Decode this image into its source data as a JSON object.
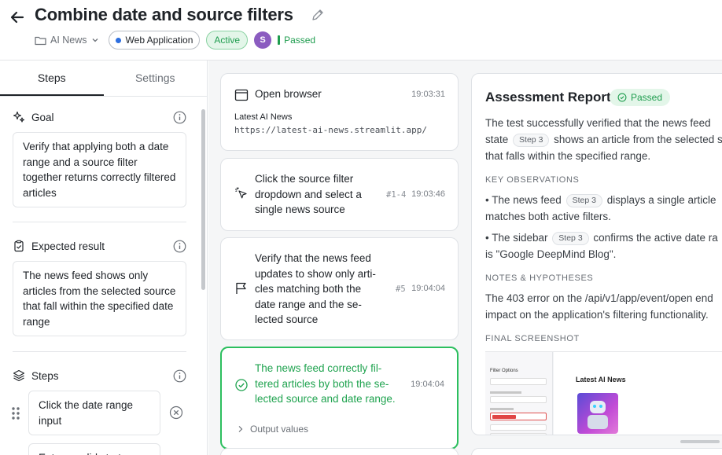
{
  "header": {
    "title": "Combine date and source filters",
    "folder": "AI News",
    "environment": "Web Application",
    "status": "Active",
    "avatar_initial": "S",
    "result": "Passed"
  },
  "left_panel": {
    "tabs": [
      "Steps",
      "Settings"
    ],
    "goal": {
      "label": "Goal",
      "text": "Verify that applying both a date range and a source filter together returns correctly filtered articles"
    },
    "expected": {
      "label": "Expected result",
      "text": "The news feed shows only articles from the selected source that fall within the specified date range"
    },
    "steps": {
      "label": "Steps",
      "items": [
        "Click the date range input",
        "Enter a valid start..."
      ]
    }
  },
  "timeline": [
    {
      "title": "Open browser",
      "time": "19:03:31",
      "subtitle": "Latest AI News",
      "url": "https://latest-ai-news.streamlit.app/"
    },
    {
      "text": "Click the source filter dropdown and select a single news source",
      "ref": "#1-4",
      "time": "19:03:46"
    },
    {
      "text": "Verify that the news feed updates to show only arti-cles matching both the date range and the se-lected source",
      "ref": "#5",
      "time": "19:04:04"
    },
    {
      "text": "The news feed correctly fil-tered articles by both the se-lected source and date range.",
      "time": "19:04:04",
      "output_label": "Output values"
    }
  ],
  "report": {
    "title": "Assessment Report",
    "badge": "Passed",
    "summary_line1": "The test successfully verified that the news feed",
    "summary_line2_pre": "state",
    "summary_chip": "Step 3",
    "summary_line2_post": "shows an article from the selected s",
    "summary_line3": "that falls within the specified range.",
    "observations_heading": "KEY OBSERVATIONS",
    "obs1_pre": "• The news feed",
    "obs1_chip": "Step 3",
    "obs1_post": "displays a single article",
    "obs1_line2": "matches both active filters.",
    "obs2_pre": "• The sidebar",
    "obs2_chip": "Step 3",
    "obs2_post": "confirms the active date ra",
    "obs2_line2": "is \"Google DeepMind Blog\".",
    "notes_heading": "NOTES & HYPOTHESES",
    "notes_line1": "The 403 error on the /api/v1/app/event/open end",
    "notes_line2": "impact on the application's filtering functionality.",
    "screenshot_heading": "FINAL SCREENSHOT",
    "screenshot": {
      "sidebar_title": "Filter Options",
      "app_title": "Latest AI News"
    }
  }
}
